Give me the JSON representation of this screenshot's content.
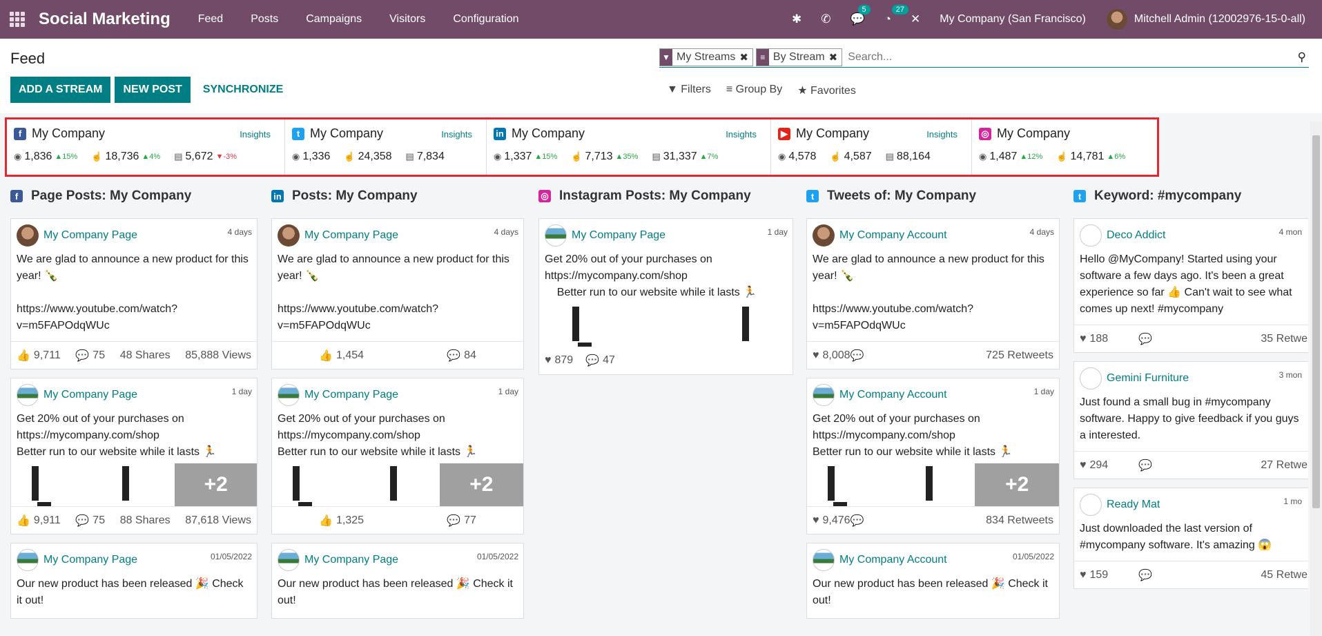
{
  "app": {
    "name": "Social Marketing",
    "menu": [
      "Feed",
      "Posts",
      "Campaigns",
      "Visitors",
      "Configuration"
    ],
    "chat_count": "5",
    "activity_count": "27",
    "company": "My Company (San Francisco)",
    "user": "Mitchell Admin (12002976-15-0-all)"
  },
  "page": {
    "title": "Feed",
    "add_stream": "ADD A STREAM",
    "new_post": "NEW POST",
    "synchronize": "SYNCHRONIZE",
    "facet_streams": "My Streams",
    "facet_group": "By Stream",
    "search_placeholder": "Search...",
    "filters": "Filters",
    "group_by": "Group By",
    "favorites": "Favorites"
  },
  "stats": [
    {
      "network": "facebook",
      "color": "#3b5998",
      "letter": "f",
      "name": "My Company",
      "insights": "Insights",
      "audience": "1,836",
      "audience_trend": "▲15%",
      "audience_dir": "up",
      "engagement": "18,736",
      "engagement_trend": "▲4%",
      "engagement_dir": "up",
      "stories": "5,672",
      "stories_trend": "▼-3%",
      "stories_dir": "down"
    },
    {
      "network": "twitter",
      "color": "#1da1f2",
      "letter": "t",
      "name": "My Company",
      "insights": "Insights",
      "audience": "1,336",
      "audience_trend": "",
      "audience_dir": "up",
      "engagement": "24,358",
      "engagement_trend": "",
      "engagement_dir": "up",
      "stories": "7,834",
      "stories_trend": "",
      "stories_dir": "up"
    },
    {
      "network": "linkedin",
      "color": "#0077b5",
      "letter": "in",
      "name": "My Company",
      "insights": "Insights",
      "audience": "1,337",
      "audience_trend": "▲15%",
      "audience_dir": "up",
      "engagement": "7,713",
      "engagement_trend": "▲35%",
      "engagement_dir": "up",
      "stories": "31,337",
      "stories_trend": "▲7%",
      "stories_dir": "up"
    },
    {
      "network": "youtube",
      "color": "#e62117",
      "letter": "▶",
      "name": "My Company",
      "insights": "Insights",
      "audience": "4,578",
      "audience_trend": "",
      "audience_dir": "up",
      "engagement": "4,587",
      "engagement_trend": "",
      "engagement_dir": "up",
      "stories": "88,164",
      "stories_trend": "",
      "stories_dir": "up"
    },
    {
      "network": "instagram",
      "color": "#d6249f",
      "letter": "◎",
      "name": "My Company",
      "insights": "",
      "audience": "1,487",
      "audience_trend": "▲12%",
      "audience_dir": "up",
      "engagement": "14,781",
      "engagement_trend": "▲6%",
      "engagement_dir": "up",
      "stories": "",
      "stories_trend": "",
      "stories_dir": "up"
    }
  ],
  "columns": [
    {
      "title": "Page Posts: My Company",
      "network": "facebook",
      "color": "#3b5998",
      "letter": "f"
    },
    {
      "title": "Posts: My Company",
      "network": "linkedin",
      "color": "#0077b5",
      "letter": "in"
    },
    {
      "title": "Instagram Posts: My Company",
      "network": "instagram",
      "color": "#d6249f",
      "letter": "◎"
    },
    {
      "title": "Tweets of: My Company",
      "network": "twitter",
      "color": "#1da1f2",
      "letter": "t"
    },
    {
      "title": "Keyword: #mycompany",
      "network": "twitter",
      "color": "#1da1f2",
      "letter": "t"
    }
  ],
  "posts": {
    "fb": [
      {
        "author": "My Company Page",
        "date": "4 days",
        "text": "We are glad to announce a new product for this year! 🍾\n\nhttps://www.youtube.com/watch?v=m5FAPOdqWUc",
        "likes": "9,711",
        "comments": "75",
        "shares": "48 Shares",
        "views": "85,888 Views"
      },
      {
        "author": "My Company Page",
        "date": "1 day",
        "text": "Get 20% out of your purchases on https://mycompany.com/shop\nBetter run to our website while it lasts 🏃",
        "likes": "9,911",
        "comments": "75",
        "shares": "88 Shares",
        "views": "87,618 Views",
        "more": "+2"
      },
      {
        "author": "My Company Page",
        "date": "01/05/2022",
        "text": "Our new product has been released 🎉 Check it out!"
      }
    ],
    "li": [
      {
        "author": "My Company Page",
        "date": "4 days",
        "text": "We are glad to announce a new product for this year! 🍾\n\nhttps://www.youtube.com/watch?v=m5FAPOdqWUc",
        "likes": "1,454",
        "comments": "84"
      },
      {
        "author": "My Company Page",
        "date": "1 day",
        "text": "Get 20% out of your purchases on https://mycompany.com/shop\nBetter run to our website while it lasts 🏃",
        "likes": "1,325",
        "comments": "77",
        "more": "+2"
      },
      {
        "author": "My Company Page",
        "date": "01/05/2022",
        "text": "Our new product has been released 🎉 Check it out!"
      }
    ],
    "ig": [
      {
        "author": "My Company Page",
        "date": "1 day",
        "text": "Get 20% out of your purchases on https://mycompany.com/shop\n    Better run to our website while it lasts 🏃",
        "likes": "879",
        "comments": "47"
      }
    ],
    "tw": [
      {
        "author": "My Company Account",
        "date": "4 days",
        "text": "We are glad to announce a new product for this year! 🍾\n\nhttps://www.youtube.com/watch?v=m5FAPOdqWUc",
        "likes": "8,008",
        "retweets": "725 Retweets"
      },
      {
        "author": "My Company Account",
        "date": "1 day",
        "text": "Get 20% out of your purchases on https://mycompany.com/shop\nBetter run to our website while it lasts 🏃",
        "likes": "9,476",
        "retweets": "834 Retweets",
        "more": "+2"
      },
      {
        "author": "My Company Account",
        "date": "01/05/2022",
        "text": "Our new product has been released 🎉 Check it out!"
      }
    ],
    "kw": [
      {
        "author": "Deco Addict",
        "date": "4 mon",
        "text": "Hello @MyCompany! Started using your software a few days ago. It's been a great experience so far 👍 Can't wait to see what comes up next! #mycompany",
        "likes": "188",
        "retweets": "35 Retwe"
      },
      {
        "author": "Gemini Furniture",
        "date": "3 mon",
        "text": "Just found a small bug in #mycompany software. Happy to give feedback if you guys a interested.",
        "likes": "294",
        "retweets": "27 Retwe"
      },
      {
        "author": "Ready Mat",
        "date": "1 mo",
        "text": "Just downloaded the last version of #mycompany software. It's amazing 😱",
        "likes": "159",
        "retweets": "45 Retwe"
      }
    ]
  }
}
